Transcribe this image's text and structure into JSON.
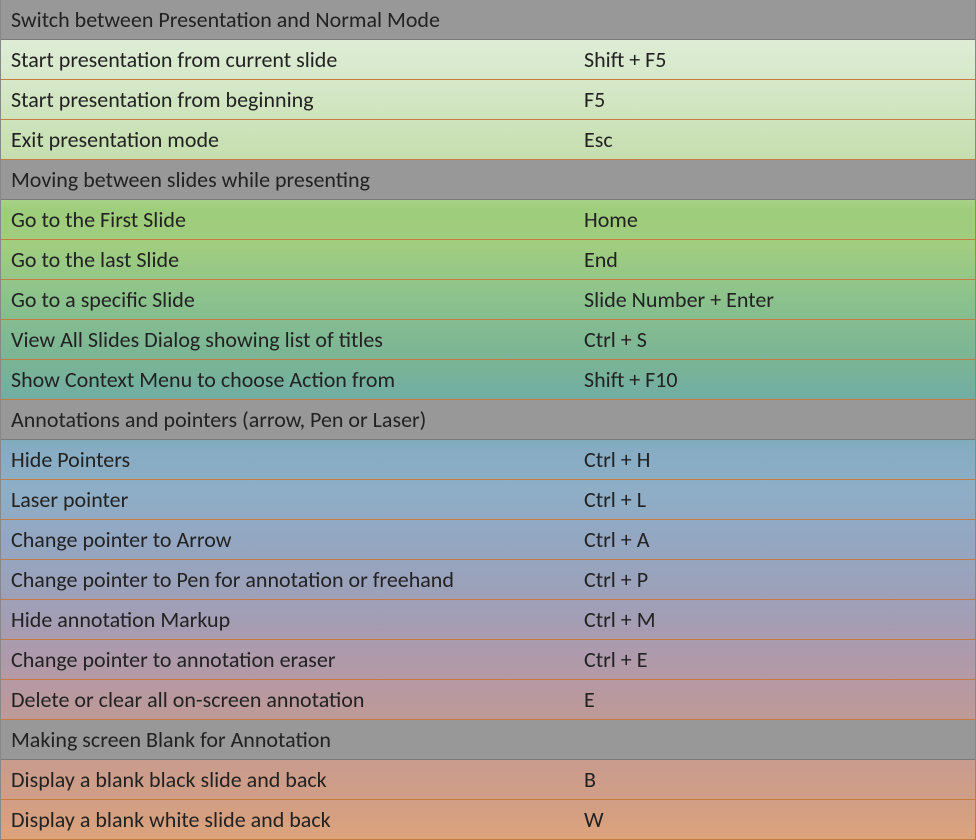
{
  "sections": [
    {
      "heading": "Switch between Presentation and Normal Mode",
      "rows": [
        {
          "action": "Start presentation from current slide",
          "shortcut": "Shift + F5"
        },
        {
          "action": "Start presentation from beginning",
          "shortcut": "F5"
        },
        {
          "action": "Exit presentation mode",
          "shortcut": "Esc"
        }
      ]
    },
    {
      "heading": "Moving between slides while presenting",
      "rows": [
        {
          "action": "Go to the First Slide",
          "shortcut": "Home"
        },
        {
          "action": "Go to the last Slide",
          "shortcut": "End"
        },
        {
          "action": "Go to a specific Slide",
          "shortcut": "Slide Number + Enter"
        },
        {
          "action": "View All Slides Dialog showing list of titles",
          "shortcut": "Ctrl + S"
        },
        {
          "action": "Show Context Menu to choose Action from",
          "shortcut": "Shift + F10"
        }
      ]
    },
    {
      "heading": "Annotations and pointers (arrow, Pen or Laser)",
      "rows": [
        {
          "action": "Hide Pointers",
          "shortcut": "Ctrl + H"
        },
        {
          "action": "Laser pointer",
          "shortcut": "Ctrl + L"
        },
        {
          "action": "Change pointer to Arrow",
          "shortcut": "Ctrl + A"
        },
        {
          "action": "Change pointer to Pen for annotation or freehand",
          "shortcut": "Ctrl +  P"
        },
        {
          "action": "Hide annotation Markup",
          "shortcut": "Ctrl + M"
        },
        {
          "action": "Change pointer to annotation eraser",
          "shortcut": "Ctrl + E"
        },
        {
          "action": "Delete or clear all on-screen annotation",
          "shortcut": "E"
        }
      ]
    },
    {
      "heading": "Making screen Blank for Annotation",
      "rows": [
        {
          "action": "Display a blank black slide and back",
          "shortcut": "B"
        },
        {
          "action": "Display a blank white slide and back",
          "shortcut": "W"
        }
      ]
    }
  ]
}
